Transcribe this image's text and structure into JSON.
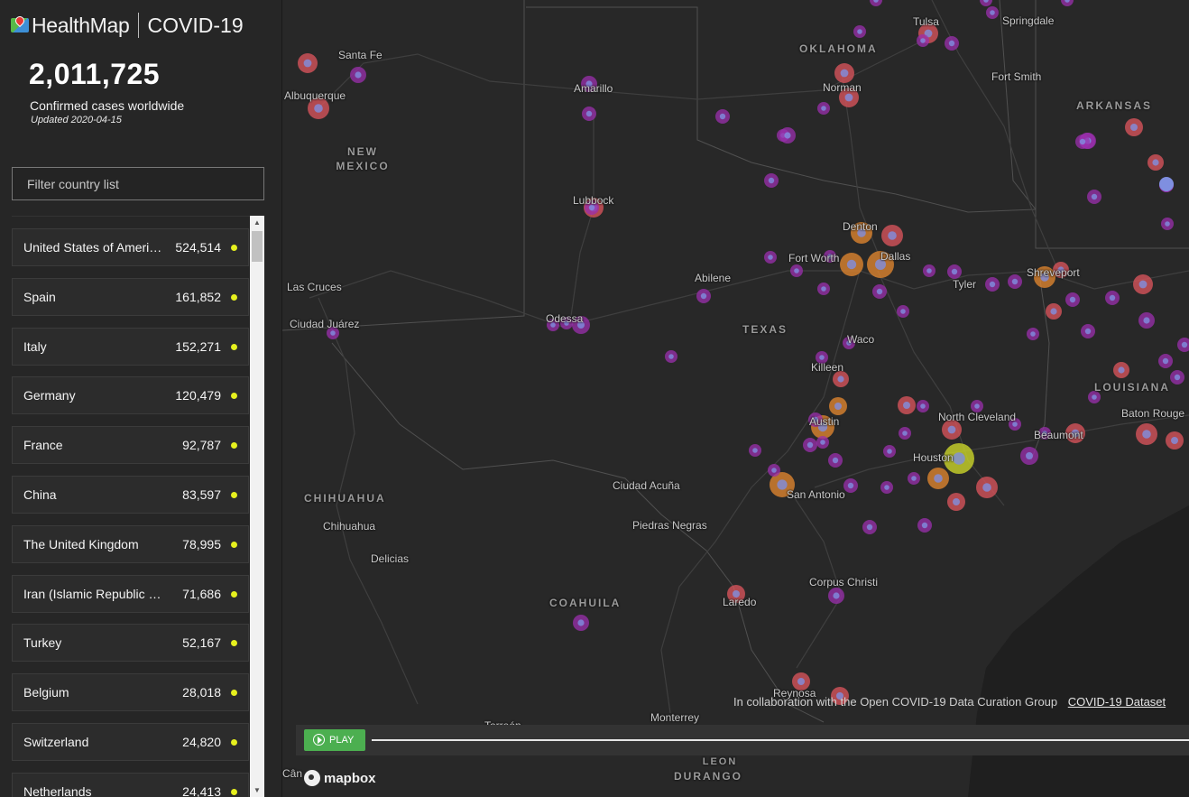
{
  "header": {
    "brand": "HealthMap",
    "product": "COVID-19"
  },
  "summary": {
    "total": "2,011,725",
    "label": "Confirmed cases worldwide",
    "updated": "Updated 2020-04-15"
  },
  "filter": {
    "placeholder": "Filter country list"
  },
  "countries": [
    {
      "name": "United States of America",
      "cases": "524,514"
    },
    {
      "name": "Spain",
      "cases": "161,852"
    },
    {
      "name": "Italy",
      "cases": "152,271"
    },
    {
      "name": "Germany",
      "cases": "120,479"
    },
    {
      "name": "France",
      "cases": "92,787"
    },
    {
      "name": "China",
      "cases": "83,597"
    },
    {
      "name": "The United Kingdom",
      "cases": "78,995"
    },
    {
      "name": "Iran (Islamic Republic of)",
      "cases": "71,686"
    },
    {
      "name": "Turkey",
      "cases": "52,167"
    },
    {
      "name": "Belgium",
      "cases": "28,018"
    },
    {
      "name": "Switzerland",
      "cases": "24,820"
    },
    {
      "name": "Netherlands",
      "cases": "24,413"
    }
  ],
  "map": {
    "states": [
      "OKLAHOMA",
      "ARKANSAS",
      "NEW MEXICO",
      "TEXAS",
      "LOUISIANA",
      "CHIHUAHUA",
      "COAHUILA",
      "DURANGO",
      "NUEVO LEON"
    ],
    "cities": [
      "Santa Fe",
      "Albuquerque",
      "Amarillo",
      "Tulsa",
      "Springdale",
      "Fort Smith",
      "Norman",
      "Lubbock",
      "Denton",
      "Fort Worth",
      "Dallas",
      "Shreveport",
      "Abilene",
      "Tyler",
      "Las Cruces",
      "Ciudad Juárez",
      "Odessa",
      "Waco",
      "Killeen",
      "Austin",
      "North Cleveland",
      "Beaumont",
      "Baton Rouge",
      "Houston",
      "San Antonio",
      "Ciudad Acuña",
      "Piedras Negras",
      "Chihuahua",
      "Delicias",
      "Corpus Christi",
      "Laredo",
      "Reynosa",
      "Monterrey",
      "Torreón",
      "Cân"
    ],
    "attribution": "In collaboration with the Open COVID-19 Data Curation Group",
    "dataset_link": "COVID-19 Dataset",
    "play_label": "PLAY",
    "mapbox": "mapbox",
    "colors": {
      "low": "#9b2fae",
      "mid": "#e0555d",
      "high": "#e8892f",
      "max": "#d6e02a",
      "center": "#7f8fe0"
    }
  }
}
